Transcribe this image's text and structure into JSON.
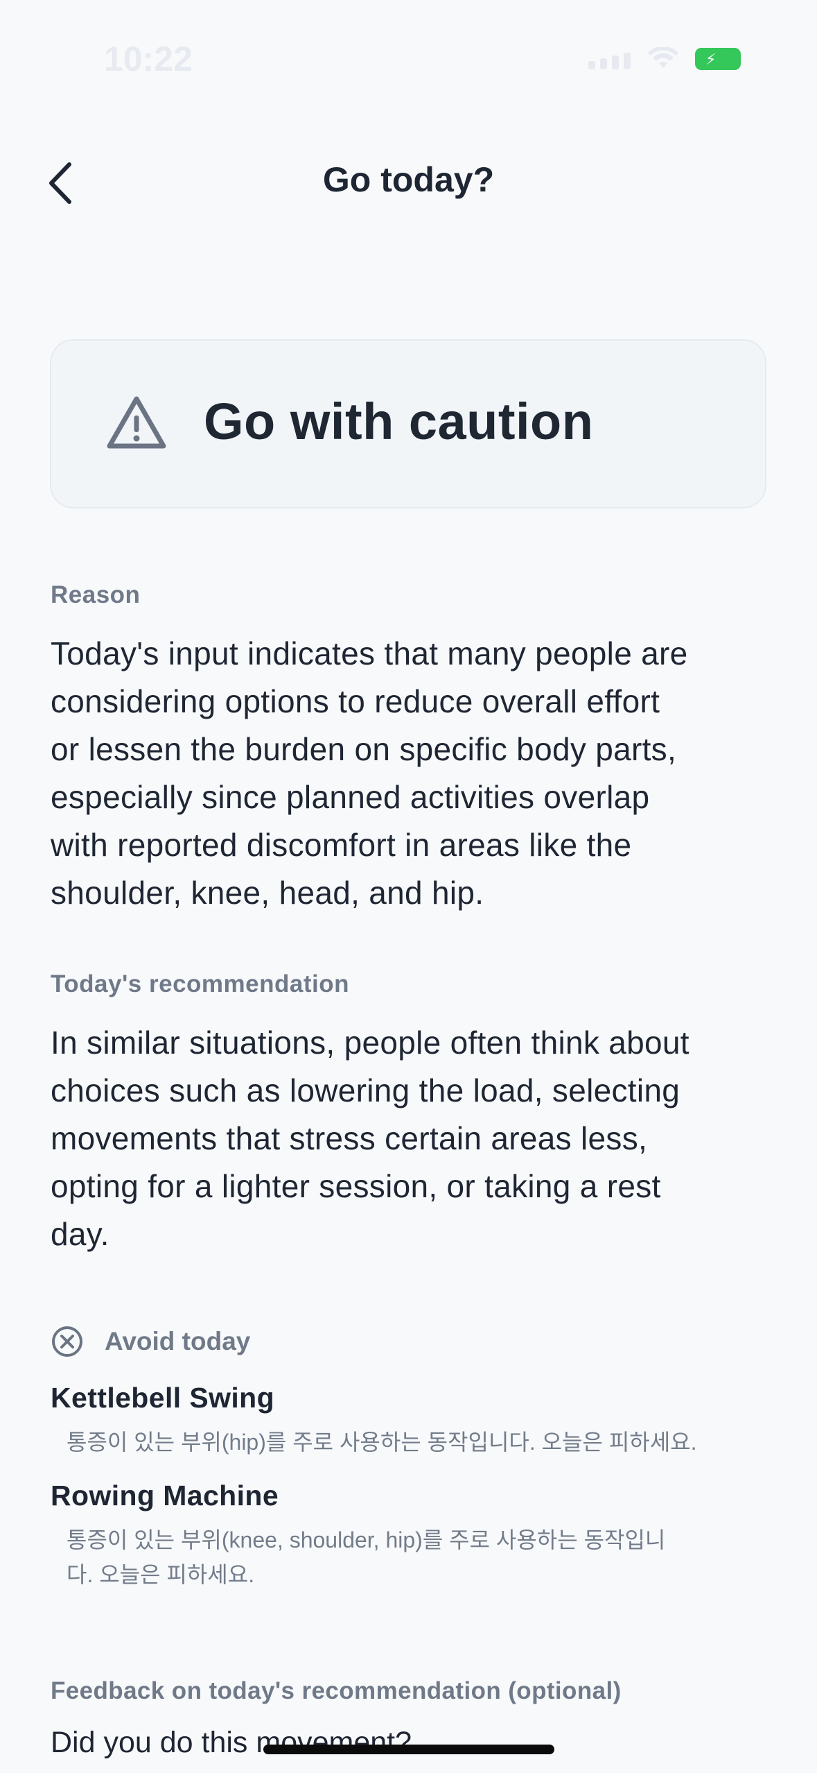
{
  "status_bar": {
    "time": "10:22"
  },
  "nav": {
    "title": "Go today?"
  },
  "verdict": {
    "label": "Go with caution",
    "icon": "warning-triangle-icon"
  },
  "reason": {
    "label": "Reason",
    "lines": [
      "Today's input indicates that many people are",
      "considering options to reduce overall effort",
      "or lessen the burden on specific body parts,",
      "especially since planned activities overlap",
      "with reported discomfort in areas like the",
      "shoulder, knee, head, and hip."
    ]
  },
  "recommendation": {
    "label": "Today's recommendation",
    "lines": [
      "In similar situations, people often think about",
      "choices such as lowering the load, selecting",
      "movements that stress certain areas less,",
      "opting for a lighter session, or taking a rest",
      "day."
    ]
  },
  "avoid": {
    "label": "Avoid today",
    "items": [
      {
        "name": "Kettlebell Swing",
        "desc_lines": [
          "통증이 있는 부위(hip)를 주로 사용하는 동작입니다. 오늘은 피하세요."
        ]
      },
      {
        "name": "Rowing Machine",
        "desc_lines": [
          "통증이 있는 부위(knee, shoulder, hip)를 주로 사용하는 동작입니",
          "다. 오늘은 피하세요."
        ]
      }
    ]
  },
  "feedback": {
    "label": "Feedback on today's recommendation (optional)",
    "question": "Did you do this movement?"
  },
  "colors": {
    "background": "#f8f9fb",
    "card": "#f2f5f8",
    "text_primary": "#1f2633",
    "text_secondary": "#6f7988",
    "battery": "#34c759"
  }
}
